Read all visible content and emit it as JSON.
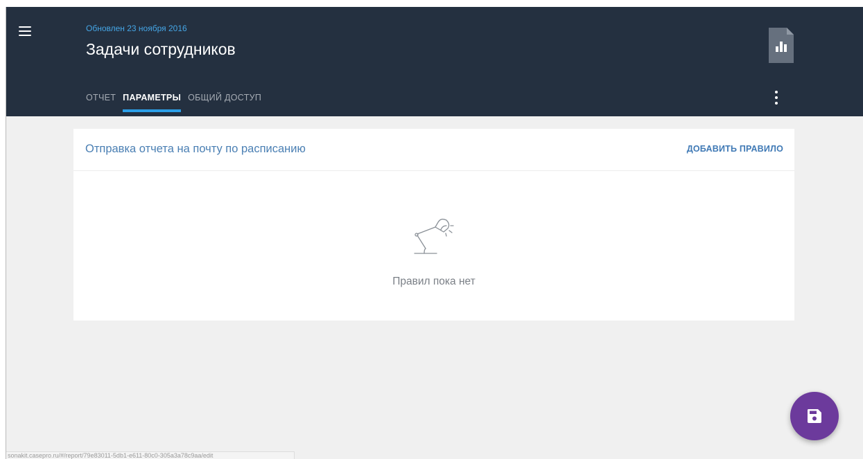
{
  "header": {
    "updated": "Обновлен 23 ноября 2016",
    "title": "Задачи сотрудников",
    "icons": {
      "menu": "hamburger-menu-icon",
      "report": "report-chart-icon",
      "more": "more-vert-icon"
    },
    "colors": {
      "background": "#243040",
      "updated_text": "#45a6e6",
      "tab_indicator": "#2c9fe8"
    }
  },
  "tabs": [
    {
      "label": "ОТЧЕТ",
      "active": false
    },
    {
      "label": "ПАРАМЕТРЫ",
      "active": true
    },
    {
      "label": "ОБЩИЙ ДОСТУП",
      "active": false
    }
  ],
  "card": {
    "title": "Отправка отчета на почту по расписанию",
    "action": "ДОБАВИТЬ ПРАВИЛО",
    "empty_icon": "desk-lamp-icon",
    "empty_text": "Правил пока нет"
  },
  "fab": {
    "icon": "save-icon",
    "color": "#6c3a9c"
  },
  "status_bar": {
    "url": "sonakit.casepro.ru/#/report/79e83011-5db1-e611-80c0-305a3a78c9aa/edit"
  }
}
